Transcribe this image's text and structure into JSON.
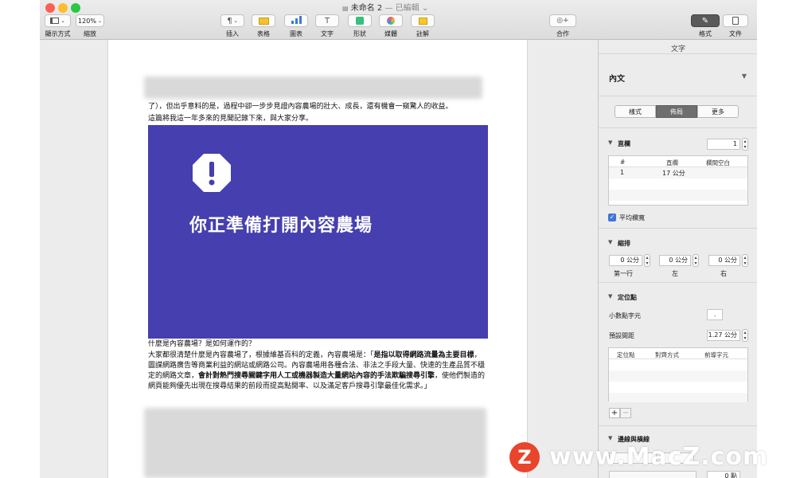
{
  "window": {
    "title": "未命名 2",
    "title_status": "— 已編輯",
    "colors": {
      "close": "#fc5f57",
      "minimize": "#fdbc2e",
      "zoom": "#28c840",
      "banner": "#453fb0",
      "accent": "#3f76d8"
    }
  },
  "toolbar": {
    "view_label": "顯示方式",
    "zoom_value": "120%",
    "zoom_label": "縮放",
    "insert_label": "插入",
    "table_label": "表格",
    "chart_label": "圖表",
    "text_label": "文字",
    "shape_label": "形狀",
    "media_label": "媒體",
    "comment_label": "註解",
    "collaborate_label": "合作",
    "format_label": "格式",
    "document_label": "文件"
  },
  "document": {
    "line1": "了），但出乎意料的是，過程中卻一步步見證內容農場的壯大、成長，還有機會一窺驚人的收益。",
    "line2": "這篇將我這一年多來的見聞記錄下來，與大家分享。",
    "banner_title": "你正準備打開內容農場",
    "heading": "什麼是內容農場？是如何運作的？",
    "para_a": "大家都很清楚什麼是內容農場了，根據維基百科的定義，內容農場是：「",
    "para_b": "是指以取得網路流量為主要目標",
    "para_c": "，圖謀網路廣告等商業利益的網站或網路公司。內容農場用各種合法、非法之手段大量、快速的生產品質不穩定的網路文章，",
    "para_d": "會計對熱門搜尋關鍵字用人工或機器製造大量網站內容的手法欺騙搜尋引擎",
    "para_e": "，使他們製造的網頁能夠優先出現在搜尋結果的前段而提高點閱率、以及滿足客戶搜尋引擎最佳化需求。」"
  },
  "inspector": {
    "header": "文字",
    "style_name": "內文",
    "tabs": [
      "樣式",
      "佈局",
      "更多"
    ],
    "columns_label": "直欄",
    "columns_value": "1",
    "columns_table_headers": [
      "#",
      "直欄",
      "欄間空白"
    ],
    "columns_table_row": [
      "1",
      "17 公分",
      ""
    ],
    "equal_width_label": "平均欄寬",
    "indent_label": "縮排",
    "indent_values": [
      "0 公分",
      "0 公分",
      "0 公分"
    ],
    "indent_captions": [
      "第一行",
      "左",
      "右"
    ],
    "tabs_section_label": "定位點",
    "decimal_label": "小數點字元",
    "decimal_value": ".",
    "default_spacing_label": "預設間距",
    "default_spacing_value": "1.27 公分",
    "tab_table_headers": [
      "定位點",
      "對齊方式",
      "前導字元"
    ],
    "borders_label": "邊線與橫線",
    "border_value": "0 點"
  },
  "watermark": {
    "logo_letter": "Z",
    "text": "www.MacZ.com"
  }
}
